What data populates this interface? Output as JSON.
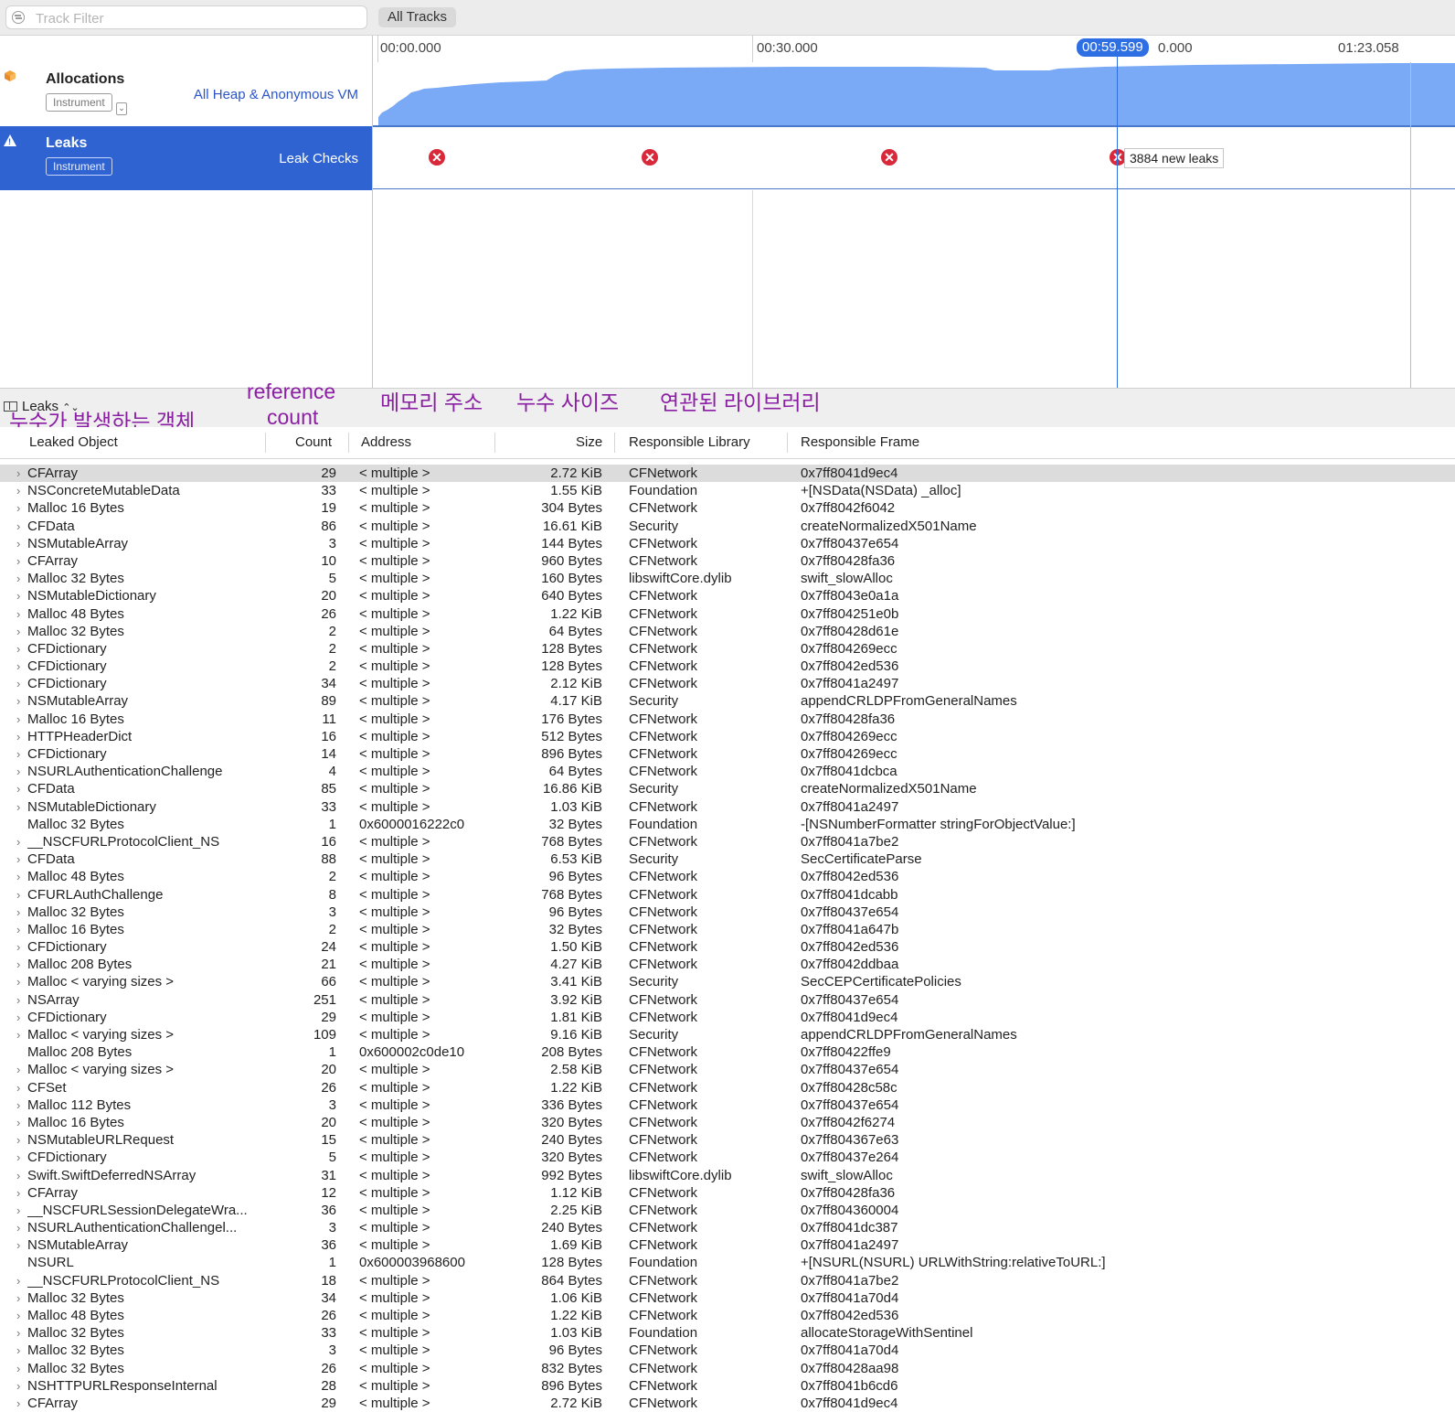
{
  "filter": {
    "placeholder": "Track Filter",
    "value": ""
  },
  "all_tracks_label": "All Tracks",
  "ruler": {
    "t0": "00:00.000",
    "t1": "00:30.000",
    "t2": "0.000",
    "t3": "01:23.058",
    "playhead": "00:59.599"
  },
  "tracks": {
    "allocations": {
      "title": "Allocations",
      "badge": "Instrument",
      "sub": "All Heap & Anonymous VM"
    },
    "leaks": {
      "title": "Leaks",
      "badge": "Instrument",
      "sub": "Leak Checks",
      "tooltip": "3884 new leaks"
    }
  },
  "detail": {
    "selector": "Leaks"
  },
  "annotations": {
    "leaked_object": "누수가 발생하는 객체",
    "reference_count_1": "reference",
    "reference_count_2": "count",
    "memory_address": "메모리 주소",
    "leak_size": "누수 사이즈",
    "library": "연관된 라이브러리"
  },
  "columns": {
    "object": "Leaked Object",
    "count": "Count",
    "address": "Address",
    "size": "Size",
    "library": "Responsible Library",
    "frame": "Responsible Frame"
  },
  "colors": {
    "accent": "#2f63d2",
    "graph_fill": "#7aaaf5",
    "leak_marker": "#d8283a",
    "annotation": "#8b1fa3"
  },
  "rows": [
    {
      "obj": "CFArray",
      "cnt": "29",
      "addr": "< multiple >",
      "size": "2.72 KiB",
      "lib": "CFNetwork",
      "frame": "0x7ff8041d9ec4",
      "exp": true
    },
    {
      "obj": "NSConcreteMutableData",
      "cnt": "33",
      "addr": "< multiple >",
      "size": "1.55 KiB",
      "lib": "Foundation",
      "frame": "+[NSData(NSData) _alloc]",
      "exp": true
    },
    {
      "obj": "Malloc 16 Bytes",
      "cnt": "19",
      "addr": "< multiple >",
      "size": "304 Bytes",
      "lib": "CFNetwork",
      "frame": "0x7ff8042f6042",
      "exp": true
    },
    {
      "obj": "CFData",
      "cnt": "86",
      "addr": "< multiple >",
      "size": "16.61 KiB",
      "lib": "Security",
      "frame": "createNormalizedX501Name",
      "exp": true
    },
    {
      "obj": "NSMutableArray",
      "cnt": "3",
      "addr": "< multiple >",
      "size": "144 Bytes",
      "lib": "CFNetwork",
      "frame": "0x7ff80437e654",
      "exp": true
    },
    {
      "obj": "CFArray",
      "cnt": "10",
      "addr": "< multiple >",
      "size": "960 Bytes",
      "lib": "CFNetwork",
      "frame": "0x7ff80428fa36",
      "exp": true
    },
    {
      "obj": "Malloc 32 Bytes",
      "cnt": "5",
      "addr": "< multiple >",
      "size": "160 Bytes",
      "lib": "libswiftCore.dylib",
      "frame": "swift_slowAlloc",
      "exp": true
    },
    {
      "obj": "NSMutableDictionary",
      "cnt": "20",
      "addr": "< multiple >",
      "size": "640 Bytes",
      "lib": "CFNetwork",
      "frame": "0x7ff8043e0a1a",
      "exp": true
    },
    {
      "obj": "Malloc 48 Bytes",
      "cnt": "26",
      "addr": "< multiple >",
      "size": "1.22 KiB",
      "lib": "CFNetwork",
      "frame": "0x7ff804251e0b",
      "exp": true
    },
    {
      "obj": "Malloc 32 Bytes",
      "cnt": "2",
      "addr": "< multiple >",
      "size": "64 Bytes",
      "lib": "CFNetwork",
      "frame": "0x7ff80428d61e",
      "exp": true
    },
    {
      "obj": "CFDictionary",
      "cnt": "2",
      "addr": "< multiple >",
      "size": "128 Bytes",
      "lib": "CFNetwork",
      "frame": "0x7ff804269ecc",
      "exp": true
    },
    {
      "obj": "CFDictionary",
      "cnt": "2",
      "addr": "< multiple >",
      "size": "128 Bytes",
      "lib": "CFNetwork",
      "frame": "0x7ff8042ed536",
      "exp": true
    },
    {
      "obj": "CFDictionary",
      "cnt": "34",
      "addr": "< multiple >",
      "size": "2.12 KiB",
      "lib": "CFNetwork",
      "frame": "0x7ff8041a2497",
      "exp": true
    },
    {
      "obj": "NSMutableArray",
      "cnt": "89",
      "addr": "< multiple >",
      "size": "4.17 KiB",
      "lib": "Security",
      "frame": "appendCRLDPFromGeneralNames",
      "exp": true
    },
    {
      "obj": "Malloc 16 Bytes",
      "cnt": "11",
      "addr": "< multiple >",
      "size": "176 Bytes",
      "lib": "CFNetwork",
      "frame": "0x7ff80428fa36",
      "exp": true
    },
    {
      "obj": "HTTPHeaderDict",
      "cnt": "16",
      "addr": "< multiple >",
      "size": "512 Bytes",
      "lib": "CFNetwork",
      "frame": "0x7ff804269ecc",
      "exp": true
    },
    {
      "obj": "CFDictionary",
      "cnt": "14",
      "addr": "< multiple >",
      "size": "896 Bytes",
      "lib": "CFNetwork",
      "frame": "0x7ff804269ecc",
      "exp": true
    },
    {
      "obj": "NSURLAuthenticationChallenge",
      "cnt": "4",
      "addr": "< multiple >",
      "size": "64 Bytes",
      "lib": "CFNetwork",
      "frame": "0x7ff8041dcbca",
      "exp": true
    },
    {
      "obj": "CFData",
      "cnt": "85",
      "addr": "< multiple >",
      "size": "16.86 KiB",
      "lib": "Security",
      "frame": "createNormalizedX501Name",
      "exp": true
    },
    {
      "obj": "NSMutableDictionary",
      "cnt": "33",
      "addr": "< multiple >",
      "size": "1.03 KiB",
      "lib": "CFNetwork",
      "frame": "0x7ff8041a2497",
      "exp": true
    },
    {
      "obj": "Malloc 32 Bytes",
      "cnt": "1",
      "addr": "0x6000016222c0",
      "size": "32 Bytes",
      "lib": "Foundation",
      "frame": "-[NSNumberFormatter stringForObjectValue:]",
      "exp": false
    },
    {
      "obj": "__NSCFURLProtocolClient_NS",
      "cnt": "16",
      "addr": "< multiple >",
      "size": "768 Bytes",
      "lib": "CFNetwork",
      "frame": "0x7ff8041a7be2",
      "exp": true
    },
    {
      "obj": "CFData",
      "cnt": "88",
      "addr": "< multiple >",
      "size": "6.53 KiB",
      "lib": "Security",
      "frame": "SecCertificateParse",
      "exp": true
    },
    {
      "obj": "Malloc 48 Bytes",
      "cnt": "2",
      "addr": "< multiple >",
      "size": "96 Bytes",
      "lib": "CFNetwork",
      "frame": "0x7ff8042ed536",
      "exp": true
    },
    {
      "obj": "CFURLAuthChallenge",
      "cnt": "8",
      "addr": "< multiple >",
      "size": "768 Bytes",
      "lib": "CFNetwork",
      "frame": "0x7ff8041dcabb",
      "exp": true
    },
    {
      "obj": "Malloc 32 Bytes",
      "cnt": "3",
      "addr": "< multiple >",
      "size": "96 Bytes",
      "lib": "CFNetwork",
      "frame": "0x7ff80437e654",
      "exp": true
    },
    {
      "obj": "Malloc 16 Bytes",
      "cnt": "2",
      "addr": "< multiple >",
      "size": "32 Bytes",
      "lib": "CFNetwork",
      "frame": "0x7ff8041a647b",
      "exp": true
    },
    {
      "obj": "CFDictionary",
      "cnt": "24",
      "addr": "< multiple >",
      "size": "1.50 KiB",
      "lib": "CFNetwork",
      "frame": "0x7ff8042ed536",
      "exp": true
    },
    {
      "obj": "Malloc 208 Bytes",
      "cnt": "21",
      "addr": "< multiple >",
      "size": "4.27 KiB",
      "lib": "CFNetwork",
      "frame": "0x7ff8042ddbaa",
      "exp": true
    },
    {
      "obj": "Malloc < varying sizes >",
      "cnt": "66",
      "addr": "< multiple >",
      "size": "3.41 KiB",
      "lib": "Security",
      "frame": "SecCEPCertificatePolicies",
      "exp": true
    },
    {
      "obj": "NSArray",
      "cnt": "251",
      "addr": "< multiple >",
      "size": "3.92 KiB",
      "lib": "CFNetwork",
      "frame": "0x7ff80437e654",
      "exp": true
    },
    {
      "obj": "CFDictionary",
      "cnt": "29",
      "addr": "< multiple >",
      "size": "1.81 KiB",
      "lib": "CFNetwork",
      "frame": "0x7ff8041d9ec4",
      "exp": true
    },
    {
      "obj": "Malloc < varying sizes >",
      "cnt": "109",
      "addr": "< multiple >",
      "size": "9.16 KiB",
      "lib": "Security",
      "frame": "appendCRLDPFromGeneralNames",
      "exp": true
    },
    {
      "obj": "Malloc 208 Bytes",
      "cnt": "1",
      "addr": "0x600002c0de10",
      "size": "208 Bytes",
      "lib": "CFNetwork",
      "frame": "0x7ff80422ffe9",
      "exp": false
    },
    {
      "obj": "Malloc < varying sizes >",
      "cnt": "20",
      "addr": "< multiple >",
      "size": "2.58 KiB",
      "lib": "CFNetwork",
      "frame": "0x7ff80437e654",
      "exp": true
    },
    {
      "obj": "CFSet",
      "cnt": "26",
      "addr": "< multiple >",
      "size": "1.22 KiB",
      "lib": "CFNetwork",
      "frame": "0x7ff80428c58c",
      "exp": true
    },
    {
      "obj": "Malloc 112 Bytes",
      "cnt": "3",
      "addr": "< multiple >",
      "size": "336 Bytes",
      "lib": "CFNetwork",
      "frame": "0x7ff80437e654",
      "exp": true
    },
    {
      "obj": "Malloc 16 Bytes",
      "cnt": "20",
      "addr": "< multiple >",
      "size": "320 Bytes",
      "lib": "CFNetwork",
      "frame": "0x7ff8042f6274",
      "exp": true
    },
    {
      "obj": "NSMutableURLRequest",
      "cnt": "15",
      "addr": "< multiple >",
      "size": "240 Bytes",
      "lib": "CFNetwork",
      "frame": "0x7ff804367e63",
      "exp": true
    },
    {
      "obj": "CFDictionary",
      "cnt": "5",
      "addr": "< multiple >",
      "size": "320 Bytes",
      "lib": "CFNetwork",
      "frame": "0x7ff80437e264",
      "exp": true
    },
    {
      "obj": "Swift.SwiftDeferredNSArray",
      "cnt": "31",
      "addr": "< multiple >",
      "size": "992 Bytes",
      "lib": "libswiftCore.dylib",
      "frame": "swift_slowAlloc",
      "exp": true
    },
    {
      "obj": "CFArray",
      "cnt": "12",
      "addr": "< multiple >",
      "size": "1.12 KiB",
      "lib": "CFNetwork",
      "frame": "0x7ff80428fa36",
      "exp": true
    },
    {
      "obj": "__NSCFURLSessionDelegateWra...",
      "cnt": "36",
      "addr": "< multiple >",
      "size": "2.25 KiB",
      "lib": "CFNetwork",
      "frame": "0x7ff804360004",
      "exp": true
    },
    {
      "obj": "NSURLAuthenticationChallengel...",
      "cnt": "3",
      "addr": "< multiple >",
      "size": "240 Bytes",
      "lib": "CFNetwork",
      "frame": "0x7ff8041dc387",
      "exp": true
    },
    {
      "obj": "NSMutableArray",
      "cnt": "36",
      "addr": "< multiple >",
      "size": "1.69 KiB",
      "lib": "CFNetwork",
      "frame": "0x7ff8041a2497",
      "exp": true
    },
    {
      "obj": "NSURL",
      "cnt": "1",
      "addr": "0x600003968600",
      "size": "128 Bytes",
      "lib": "Foundation",
      "frame": "+[NSURL(NSURL) URLWithString:relativeToURL:]",
      "exp": false
    },
    {
      "obj": "__NSCFURLProtocolClient_NS",
      "cnt": "18",
      "addr": "< multiple >",
      "size": "864 Bytes",
      "lib": "CFNetwork",
      "frame": "0x7ff8041a7be2",
      "exp": true
    },
    {
      "obj": "Malloc 32 Bytes",
      "cnt": "34",
      "addr": "< multiple >",
      "size": "1.06 KiB",
      "lib": "CFNetwork",
      "frame": "0x7ff8041a70d4",
      "exp": true
    },
    {
      "obj": "Malloc 48 Bytes",
      "cnt": "26",
      "addr": "< multiple >",
      "size": "1.22 KiB",
      "lib": "CFNetwork",
      "frame": "0x7ff8042ed536",
      "exp": true
    },
    {
      "obj": "Malloc 32 Bytes",
      "cnt": "33",
      "addr": "< multiple >",
      "size": "1.03 KiB",
      "lib": "Foundation",
      "frame": "allocateStorageWithSentinel",
      "exp": true
    },
    {
      "obj": "Malloc 32 Bytes",
      "cnt": "3",
      "addr": "< multiple >",
      "size": "96 Bytes",
      "lib": "CFNetwork",
      "frame": "0x7ff8041a70d4",
      "exp": true
    },
    {
      "obj": "Malloc 32 Bytes",
      "cnt": "26",
      "addr": "< multiple >",
      "size": "832 Bytes",
      "lib": "CFNetwork",
      "frame": "0x7ff80428aa98",
      "exp": true
    },
    {
      "obj": "NSHTTPURLResponseInternal",
      "cnt": "28",
      "addr": "< multiple >",
      "size": "896 Bytes",
      "lib": "CFNetwork",
      "frame": "0x7ff8041b6cd6",
      "exp": true
    },
    {
      "obj": "CFArray",
      "cnt": "29",
      "addr": "< multiple >",
      "size": "2.72 KiB",
      "lib": "CFNetwork",
      "frame": "0x7ff8041d9ec4",
      "exp": true
    }
  ]
}
